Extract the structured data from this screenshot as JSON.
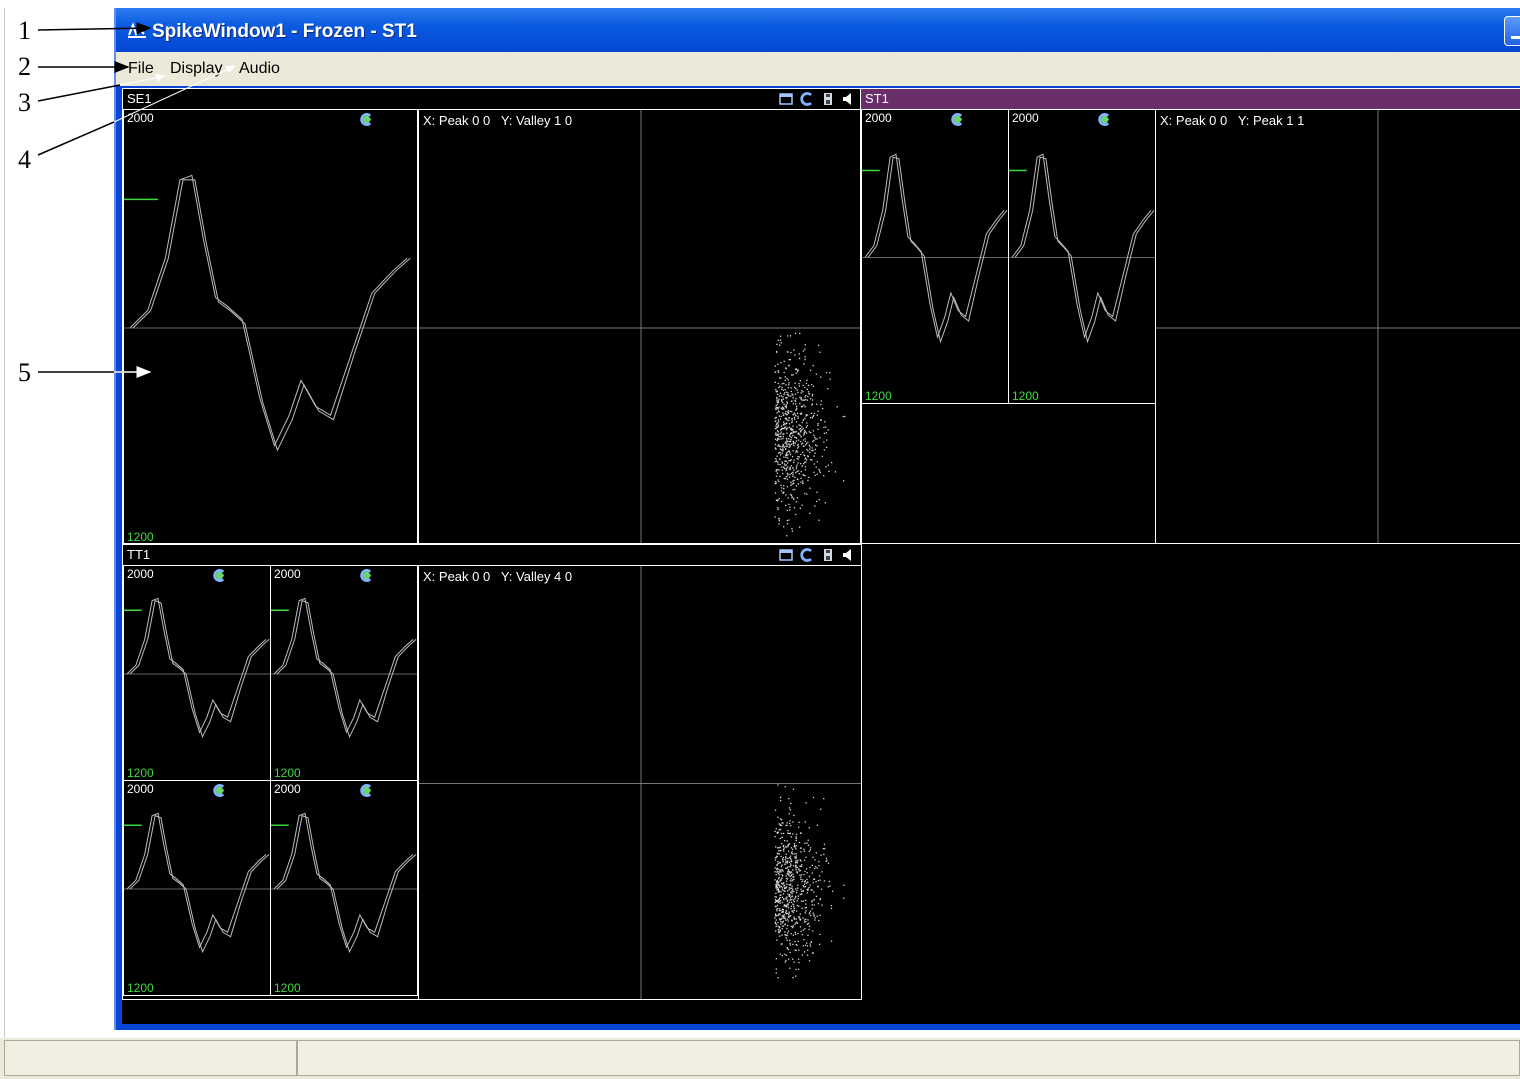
{
  "callouts": [
    "1",
    "2",
    "3",
    "4",
    "5"
  ],
  "window": {
    "title": "SpikeWindow1  -  Frozen  -  ST1",
    "title_icon": "spike-app-icon",
    "controls": [
      "minimize-icon"
    ]
  },
  "menu": {
    "items": [
      {
        "label": "File"
      },
      {
        "label": "Display"
      },
      {
        "label": "Audio"
      }
    ]
  },
  "colors": {
    "titlebar": "#0a5be0",
    "menubar": "#ece9d8",
    "client_bg": "#000000",
    "active_header": "#6a2f6a",
    "ymin_label": "#3fd93f",
    "tick_green": "#3fd93f",
    "waveform": "#bcbcbc",
    "icon_green": "#6dd36d",
    "icon_blue": "#7fb2ff"
  },
  "header_icons": [
    "window-icon",
    "clear-icon",
    "save-icon",
    "speaker-icon"
  ],
  "wave_icons": [
    "arrow-down-icon",
    "arrow-up-icon",
    "clear-icon"
  ],
  "panels": {
    "se1": {
      "label": "SE1",
      "waves": [
        {
          "ymax": "2000",
          "ymin": "1200"
        }
      ],
      "scatter": {
        "x_label": "X: Peak 0 0",
        "y_label": "Y: Valley 1 0"
      }
    },
    "st1": {
      "label": "ST1",
      "waves": [
        {
          "ymax": "2000",
          "ymin": "1200"
        },
        {
          "ymax": "2000",
          "ymin": "1200"
        }
      ],
      "scatter": {
        "x_label": "X: Peak 0 0",
        "y_label": "Y: Peak 1 1"
      }
    },
    "tt1": {
      "label": "TT1",
      "waves": [
        {
          "ymax": "2000",
          "ymin": "1200"
        },
        {
          "ymax": "2000",
          "ymin": "1200"
        },
        {
          "ymax": "2000",
          "ymin": "1200"
        },
        {
          "ymax": "2000",
          "ymin": "1200"
        }
      ],
      "scatter": {
        "x_label": "X: Peak 0 0",
        "y_label": "Y: Valley 4 0"
      }
    }
  }
}
